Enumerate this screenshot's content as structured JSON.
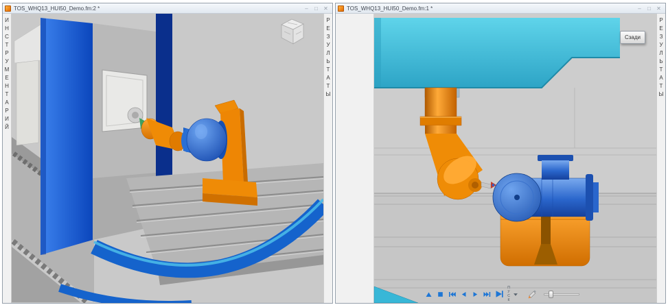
{
  "windows": {
    "left": {
      "title": "TOS_WHQ13_HUI50_Demo.fm:2 *",
      "tools_tab": "ИНСТРУМЕНТАРИЙ",
      "results_tab": "РЕЗУЛЬТАТЫ"
    },
    "right": {
      "title": "TOS_WHQ13_HUI50_Demo.fm:1 *",
      "results_tab": "РЕЗУЛЬТАТЫ",
      "view_label": "Сзади"
    }
  },
  "window_controls": {
    "minimize": "–",
    "maximize": "□",
    "close": "✕"
  },
  "playback": {
    "run_label": "ПУСК",
    "icons": [
      "up",
      "stop",
      "skip-to-start",
      "step-back",
      "play",
      "skip-to-end",
      "run",
      "dropdown",
      "pencil",
      "speed-slider"
    ]
  },
  "colors": {
    "machine_blue": "#0b46bc",
    "machine_navy": "#0a2f8c",
    "machine_cyan": "#3fc0de",
    "machine_orange": "#ef8b06",
    "workpiece_blue": "#2a6fd4",
    "playback_icon_blue": "#1d76d6"
  }
}
